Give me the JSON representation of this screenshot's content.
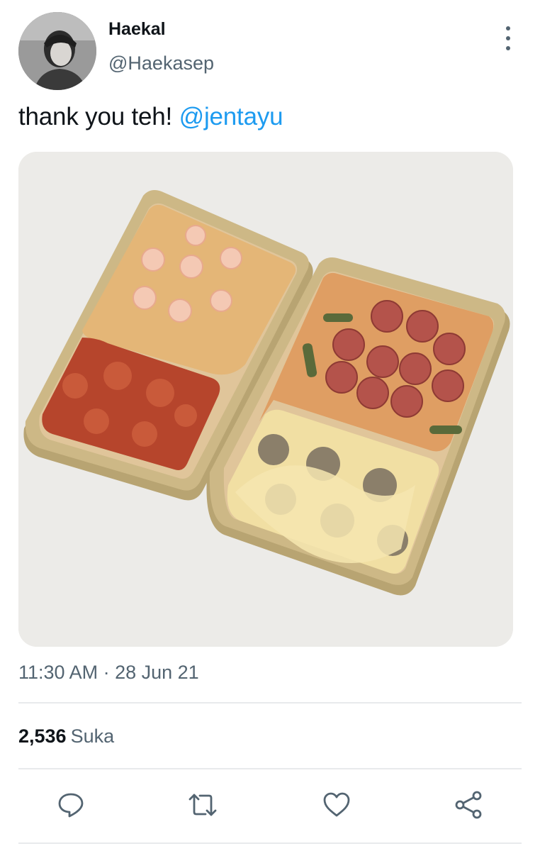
{
  "tweet": {
    "author": {
      "display_name": "Haekal",
      "handle": "@Haekasep"
    },
    "text": "thank you teh! ",
    "mention": "@jentayu",
    "timestamp": "11:30 AM · 28 Jun 21"
  },
  "stats": {
    "like_count": "2,536",
    "like_label": "Suka"
  },
  "actions": {
    "icons": [
      "reply-icon",
      "retweet-icon",
      "like-icon",
      "share-icon"
    ]
  },
  "colors": {
    "accent": "#1d9bf0",
    "text": "#0f1419",
    "secondary": "#536471",
    "divider": "#e8eaec"
  }
}
